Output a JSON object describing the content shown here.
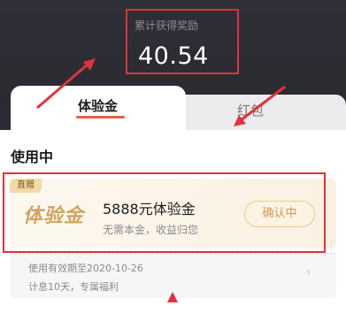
{
  "reward": {
    "label": "累计获得奖励",
    "value": "40.54"
  },
  "tabs": [
    {
      "label": "体验金",
      "active": true
    },
    {
      "label": "红包",
      "active": false
    }
  ],
  "section": {
    "title": "使用中"
  },
  "card": {
    "badge": "直赠",
    "logo_text": "体验金",
    "title": "5888元体验金",
    "description": "无需本金，收益归您",
    "button_label": "确认中"
  },
  "details": {
    "line1": "使用有效期至2020-10-26",
    "line2": "计息10天，专属福利"
  },
  "colors": {
    "highlight": "#e0323a",
    "accent_gold": "#d2a460",
    "tab_underline": "#e56145"
  },
  "icons": {
    "chevron": "chevron-right-icon"
  }
}
